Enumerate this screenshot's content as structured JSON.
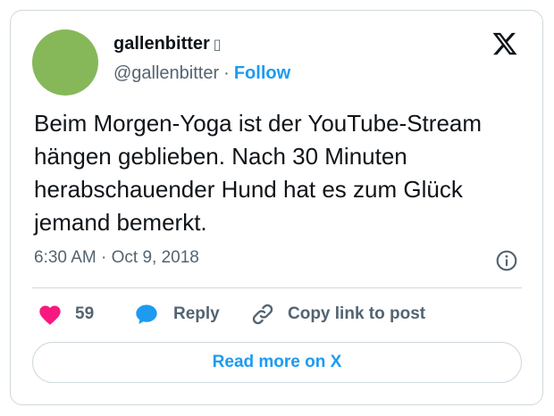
{
  "author": {
    "display_name": "gallenbitter",
    "name_glyph": "▯",
    "handle": "@gallenbitter",
    "separator": "·",
    "follow_label": "Follow"
  },
  "tweet": {
    "text": "Beim Morgen-Yoga ist der YouTube-Stream hängen geblieben. Nach 30 Minuten herabschauender Hund hat es zum Glück jemand bemerkt.",
    "time": "6:30 AM",
    "date_separator": "·",
    "date": "Oct 9, 2018"
  },
  "actions": {
    "like_count": "59",
    "reply_label": "Reply",
    "copy_label": "Copy link to post"
  },
  "read_more_label": "Read more on X",
  "colors": {
    "accent": "#1d9bf0",
    "like": "#f91880",
    "avatar": "#86b859",
    "muted": "#536471",
    "border": "#cfd9de"
  },
  "icons": {
    "brand": "x-logo-icon",
    "info": "info-icon",
    "like": "heart-icon",
    "reply": "speech-bubble-icon",
    "copy": "link-icon"
  }
}
